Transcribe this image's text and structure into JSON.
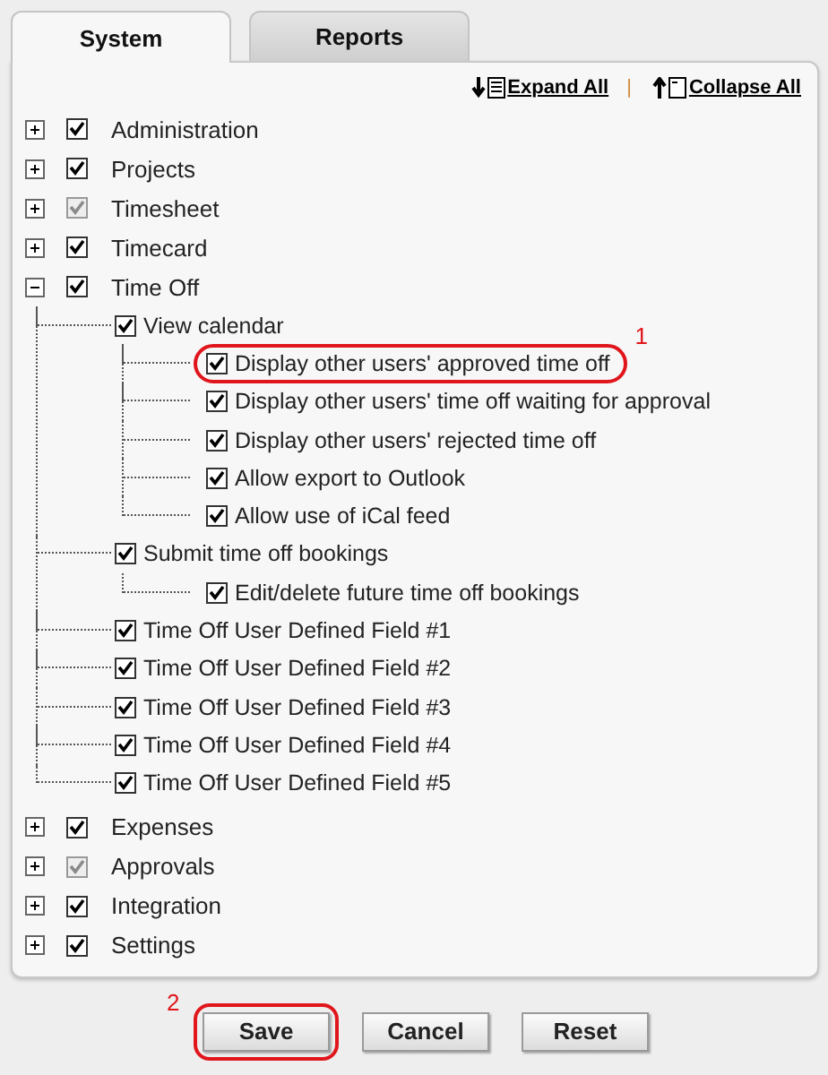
{
  "tabs": [
    {
      "label": "System",
      "selected": true
    },
    {
      "label": "Reports",
      "selected": false
    }
  ],
  "tree_actions": [
    {
      "label": "Expand All",
      "kind": "expand"
    },
    {
      "label": "Collapse All",
      "kind": "collapse"
    }
  ],
  "separator": "|",
  "tree": [
    {
      "label": "Administration",
      "expanded": false,
      "checked": true,
      "greyed": false
    },
    {
      "label": "Projects",
      "expanded": false,
      "checked": true,
      "greyed": false
    },
    {
      "label": "Timesheet",
      "expanded": false,
      "checked": true,
      "greyed": true
    },
    {
      "label": "Timecard",
      "expanded": false,
      "checked": true,
      "greyed": false
    },
    {
      "label": "Time Off",
      "expanded": true,
      "checked": true,
      "greyed": false,
      "children": [
        {
          "label": "View calendar",
          "checked": true,
          "children": [
            {
              "label": "Display other users' approved time off",
              "checked": true,
              "highlighted": true,
              "callout": "1"
            },
            {
              "label": "Display other users' time off waiting for approval",
              "checked": true,
              "highlighted": false
            },
            {
              "label": "Display other users' rejected time off",
              "checked": true,
              "highlighted": false
            },
            {
              "label": "Allow export to Outlook",
              "checked": true,
              "highlighted": false
            },
            {
              "label": "Allow use of iCal feed",
              "checked": true,
              "highlighted": false
            }
          ]
        },
        {
          "label": "Submit time off bookings",
          "checked": true,
          "children": [
            {
              "label": "Edit/delete future time off bookings",
              "checked": true,
              "highlighted": false
            }
          ]
        },
        {
          "label": "Time Off User Defined Field #1",
          "checked": true
        },
        {
          "label": "Time Off User Defined Field #2",
          "checked": true
        },
        {
          "label": "Time Off User Defined Field #3",
          "checked": true
        },
        {
          "label": "Time Off User Defined Field #4",
          "checked": true
        },
        {
          "label": "Time Off User Defined Field #5",
          "checked": true
        }
      ]
    },
    {
      "label": "Expenses",
      "expanded": false,
      "checked": true,
      "greyed": false
    },
    {
      "label": "Approvals",
      "expanded": false,
      "checked": true,
      "greyed": true
    },
    {
      "label": "Integration",
      "expanded": false,
      "checked": true,
      "greyed": false
    },
    {
      "label": "Settings",
      "expanded": false,
      "checked": true,
      "greyed": false
    }
  ],
  "buttons": [
    {
      "label": "Save",
      "highlighted": true,
      "callout": "2"
    },
    {
      "label": "Cancel",
      "highlighted": false
    },
    {
      "label": "Reset",
      "highlighted": false
    }
  ]
}
